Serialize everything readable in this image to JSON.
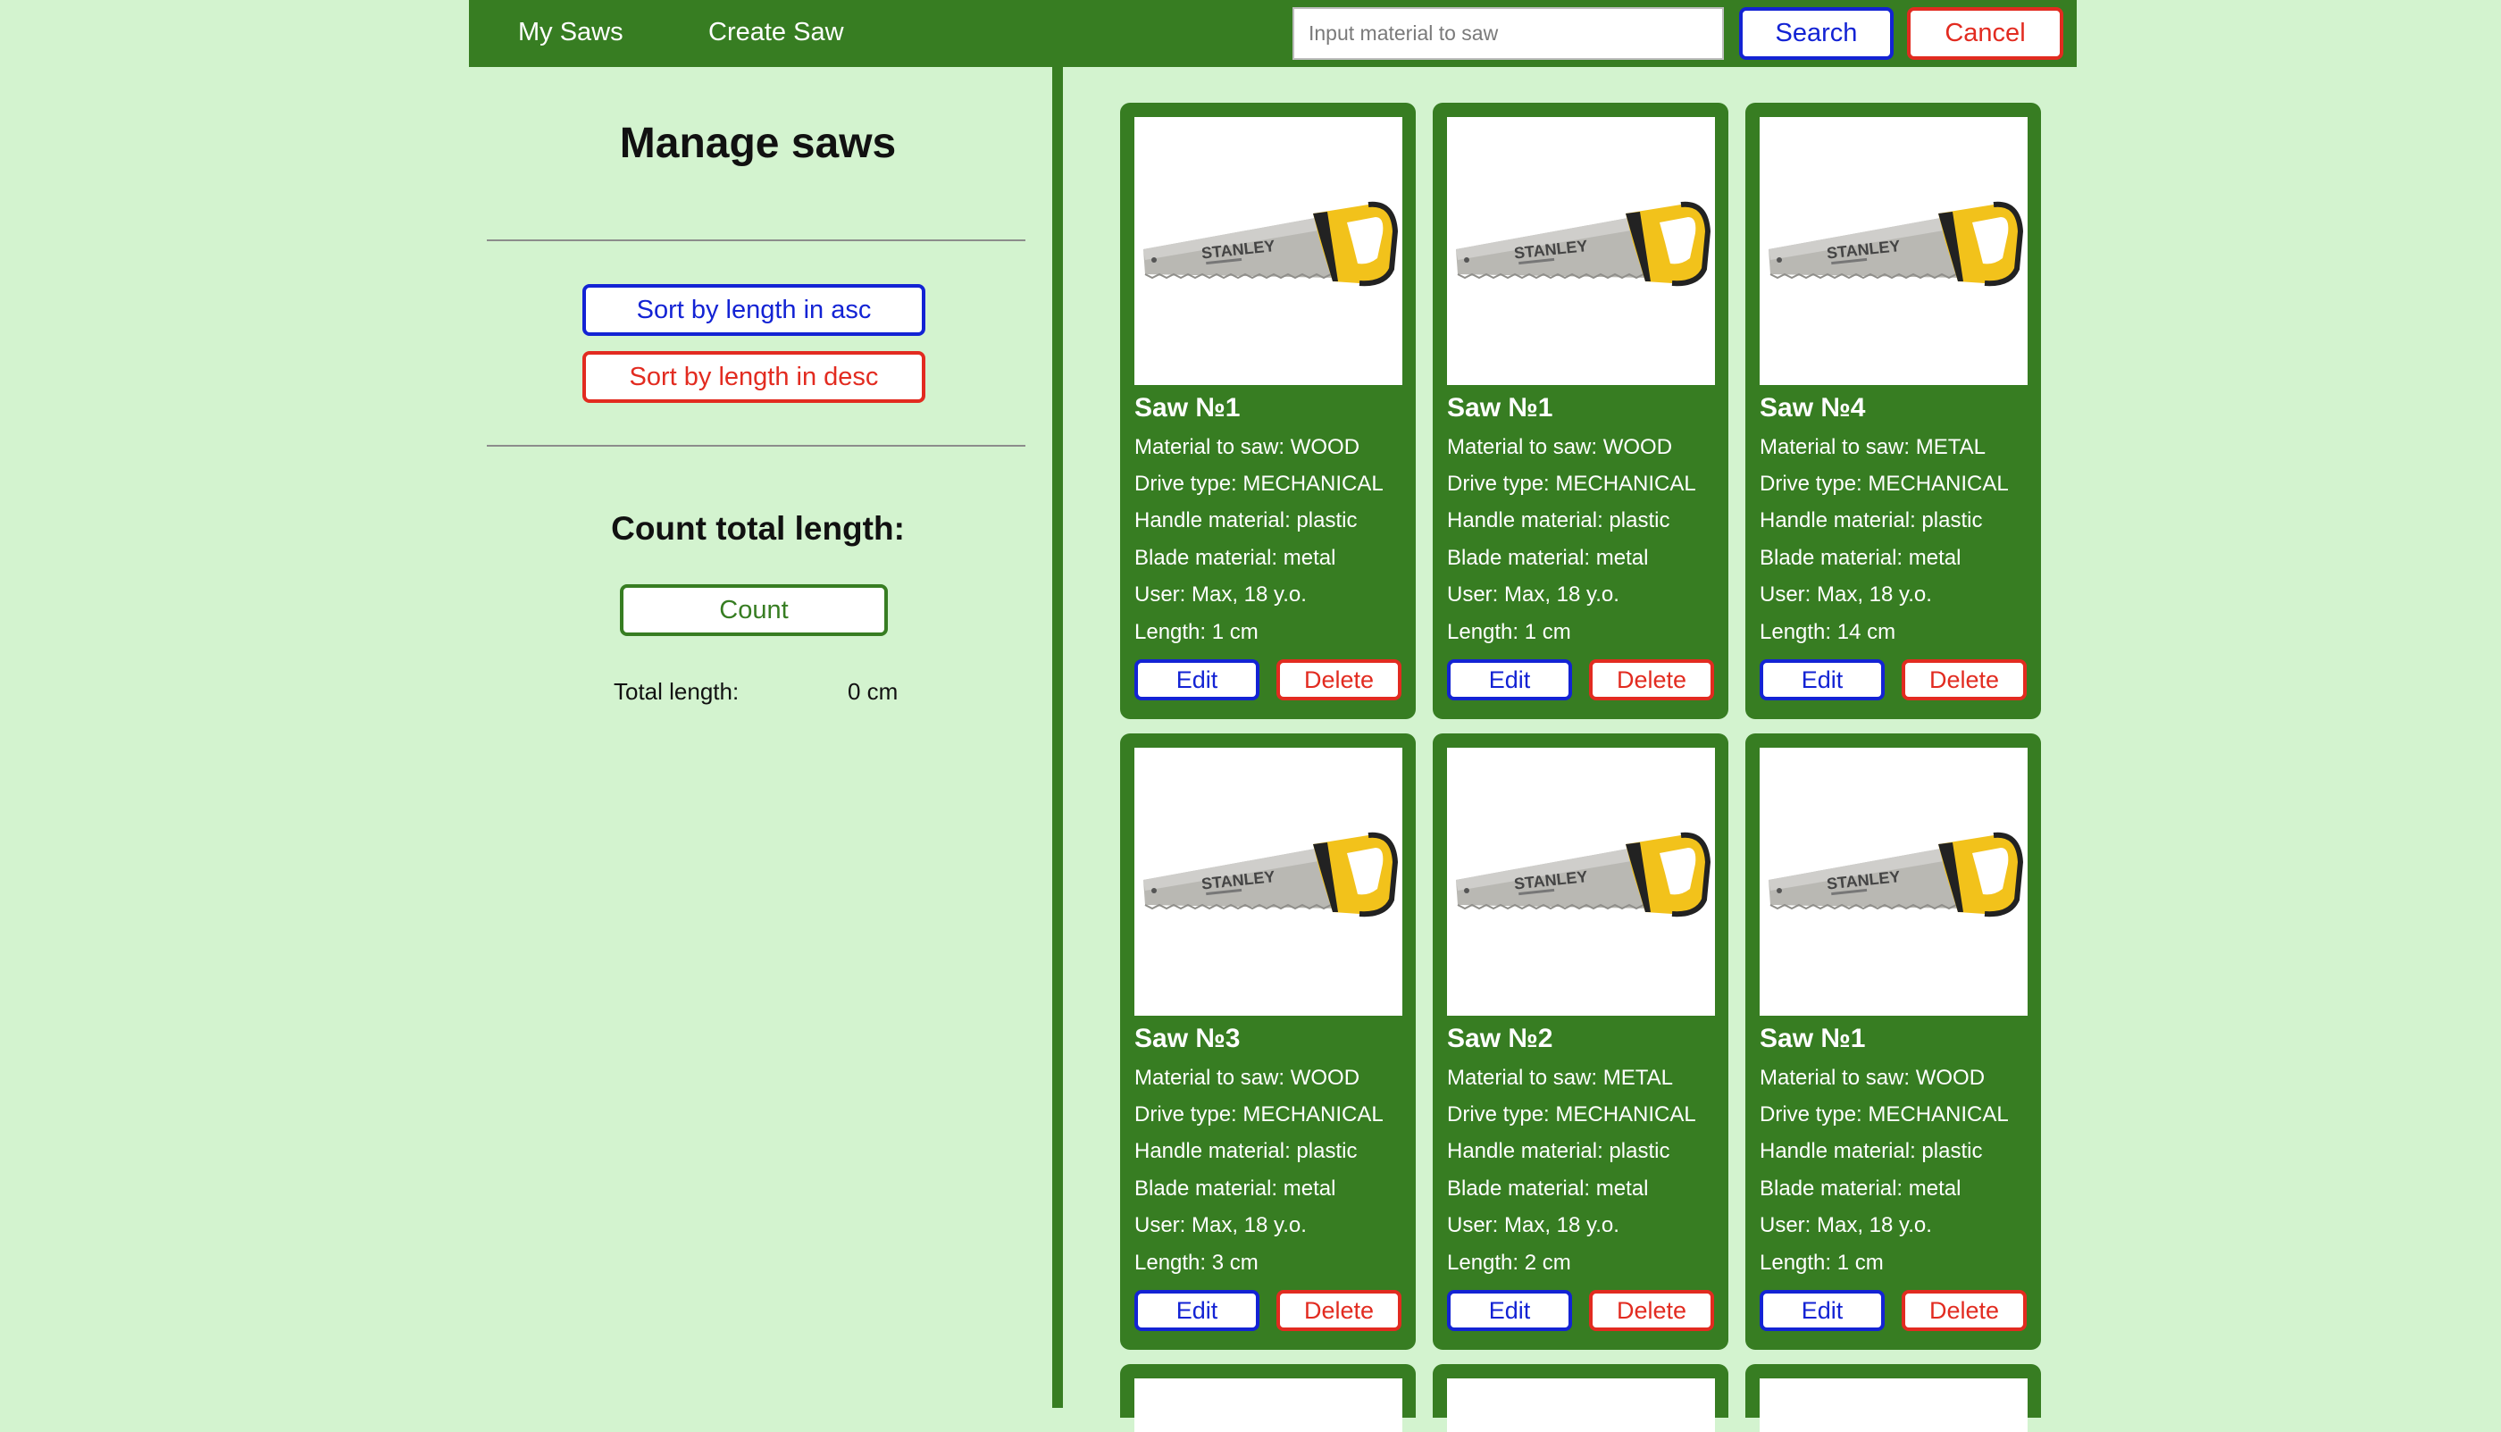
{
  "nav": {
    "my_saws": "My Saws",
    "create_saw": "Create Saw",
    "search_placeholder": "Input material to saw",
    "search_label": "Search",
    "cancel_label": "Cancel"
  },
  "sidebar": {
    "title": "Manage saws",
    "sort_asc_label": "Sort by length in asc",
    "sort_desc_label": "Sort by length in desc",
    "count_title": "Count total length:",
    "count_label": "Count",
    "total_label": "Total length:",
    "total_value": "0 cm"
  },
  "cards": [
    {
      "title": "Saw №1",
      "material": "Material to saw: WOOD",
      "drive": "Drive type: MECHANICAL",
      "handle": "Handle material: plastic",
      "blade": "Blade material: metal",
      "user": "User: Max, 18 y.o.",
      "length": "Length: 1 cm",
      "edit": "Edit",
      "delete": "Delete"
    },
    {
      "title": "Saw №1",
      "material": "Material to saw: WOOD",
      "drive": "Drive type: MECHANICAL",
      "handle": "Handle material: plastic",
      "blade": "Blade material: metal",
      "user": "User: Max, 18 y.o.",
      "length": "Length: 1 cm",
      "edit": "Edit",
      "delete": "Delete"
    },
    {
      "title": "Saw №4",
      "material": "Material to saw: METAL",
      "drive": "Drive type: MECHANICAL",
      "handle": "Handle material: plastic",
      "blade": "Blade material: metal",
      "user": "User: Max, 18 y.o.",
      "length": "Length: 14 cm",
      "edit": "Edit",
      "delete": "Delete"
    },
    {
      "title": "Saw №3",
      "material": "Material to saw: WOOD",
      "drive": "Drive type: MECHANICAL",
      "handle": "Handle material: plastic",
      "blade": "Blade material: metal",
      "user": "User: Max, 18 y.o.",
      "length": "Length: 3 cm",
      "edit": "Edit",
      "delete": "Delete"
    },
    {
      "title": "Saw №2",
      "material": "Material to saw: METAL",
      "drive": "Drive type: MECHANICAL",
      "handle": "Handle material: plastic",
      "blade": "Blade material: metal",
      "user": "User: Max, 18 y.o.",
      "length": "Length: 2 cm",
      "edit": "Edit",
      "delete": "Delete"
    },
    {
      "title": "Saw №1",
      "material": "Material to saw: WOOD",
      "drive": "Drive type: MECHANICAL",
      "handle": "Handle material: plastic",
      "blade": "Blade material: metal",
      "user": "User: Max, 18 y.o.",
      "length": "Length: 1 cm",
      "edit": "Edit",
      "delete": "Delete"
    }
  ],
  "saw_image": {
    "brand": "STANLEY"
  },
  "colors": {
    "background": "#d3f3cf",
    "primary_green": "#377d22",
    "blue": "#1323d4",
    "red": "#e22b20"
  }
}
